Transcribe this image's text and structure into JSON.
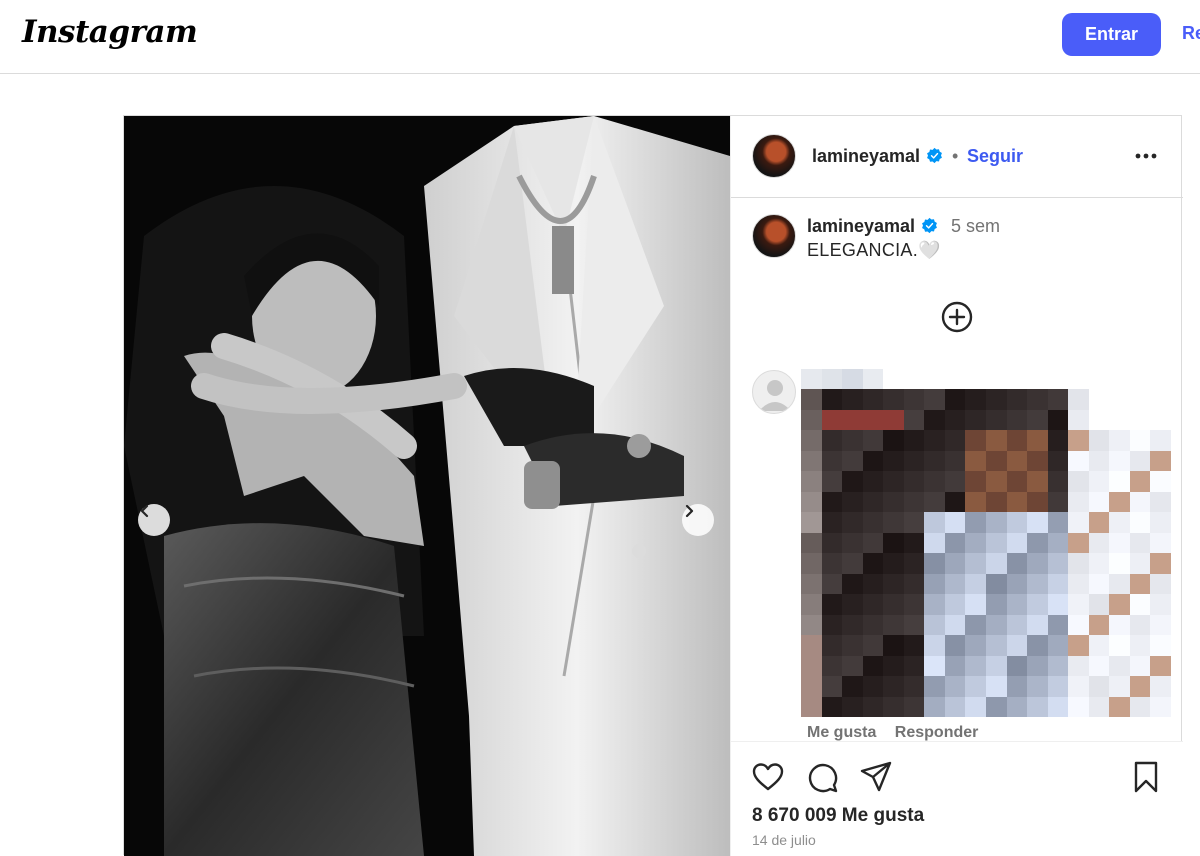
{
  "topbar": {
    "logo": "Instagram",
    "login_label": "Entrar",
    "signup_label": "Re"
  },
  "post": {
    "username": "lamineyamal",
    "follow_label": "Seguir",
    "caption_time": "5 sem",
    "caption_text": "ELEGANCIA.🤍",
    "likes": "8 670 009 Me gusta",
    "date": "14 de julio"
  },
  "comment": {
    "like_label": "Me gusta",
    "reply_label": "Responder"
  },
  "icons": {
    "verified": "verified-badge-icon",
    "more": "more-options-icon",
    "add": "add-circle-icon",
    "like": "heart-icon",
    "comment": "comment-icon",
    "share": "send-icon",
    "save": "bookmark-icon",
    "prev": "chevron-left-icon",
    "next": "chevron-right-icon",
    "profile": "default-profile-icon"
  },
  "colors": {
    "accent": "#4a5df9",
    "link": "#3d5af1",
    "verified": "#0095f6",
    "text": "#262626",
    "muted": "#737373"
  }
}
